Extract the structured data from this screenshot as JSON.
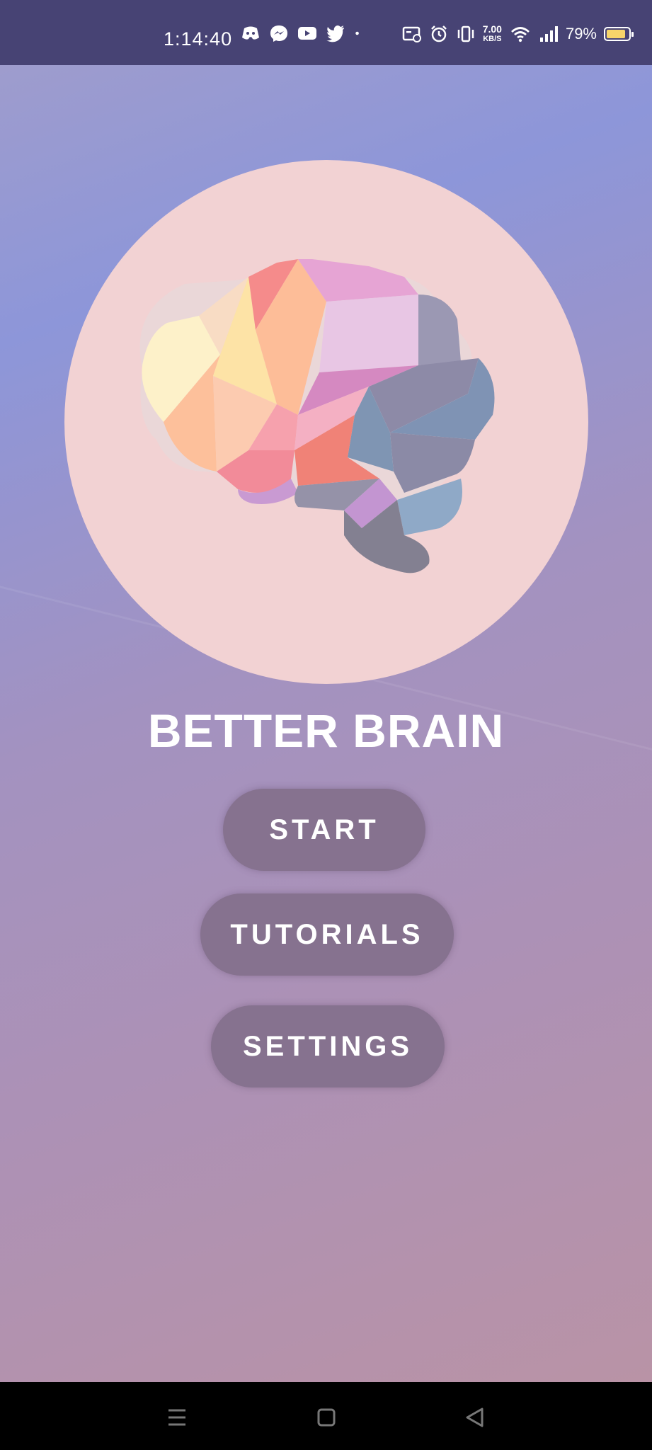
{
  "status_bar": {
    "time": "1:14:40",
    "net_speed_value": "7.00",
    "net_speed_unit": "KB/S",
    "battery_percent": "79%",
    "icons": [
      "discord-icon",
      "messenger-icon",
      "youtube-icon",
      "twitter-icon",
      "dot-icon",
      "nfc-icon",
      "alarm-icon",
      "vibrate-icon",
      "wifi-icon",
      "signal-icon",
      "battery-icon"
    ]
  },
  "app": {
    "title": "BETTER BRAIN",
    "buttons": {
      "start": "START",
      "tutorials": "TUTORIALS",
      "settings": "SETTINGS"
    }
  },
  "nav_bar": {
    "icons": [
      "menu-icon",
      "home-icon",
      "back-icon"
    ]
  },
  "colors": {
    "status_bar_bg": "#474374",
    "logo_circle_bg": "#f2d2d3",
    "button_bg": "#86728f",
    "title_text": "#ffffff"
  }
}
